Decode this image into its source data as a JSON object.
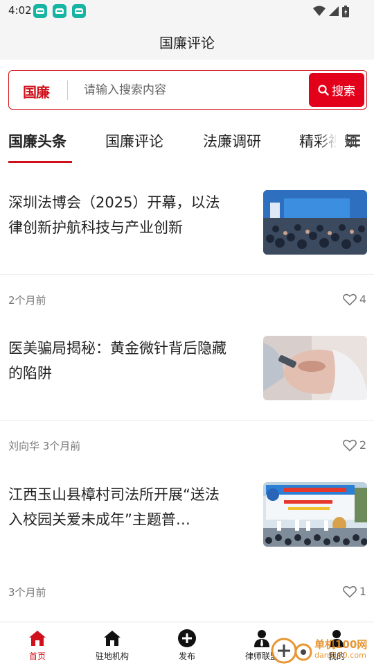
{
  "status_bar": {
    "time": "4:02",
    "notification_icons": [
      "car-app-icon",
      "car-app-icon",
      "car-app-icon"
    ],
    "system_icons": [
      "wifi-icon",
      "signal-icon",
      "battery-icon"
    ]
  },
  "header": {
    "title": "国廉评论"
  },
  "search": {
    "logo_text": "国廉",
    "placeholder": "请输入搜索内容",
    "button_label": "搜索"
  },
  "tabs": [
    {
      "label": "国廉头条",
      "active": true
    },
    {
      "label": "国廉评论",
      "active": false
    },
    {
      "label": "法廉调研",
      "active": false
    },
    {
      "label": "精彩视频",
      "active": false
    }
  ],
  "articles": [
    {
      "title": "深圳法博会（2025）开幕，以法律创新护航科技与产业创新",
      "author": "",
      "time": "2个月前",
      "meta": "2个月前",
      "likes": "4"
    },
    {
      "title": "医美骗局揭秘：黄金微针背后隐藏的陷阱",
      "author": "刘向华",
      "time": "3个月前",
      "meta": "刘向华 3个月前",
      "likes": "2"
    },
    {
      "title": "江西玉山县樟村司法所开展“送法入校园关爱未成年”主题普…",
      "author": "",
      "time": "3个月前",
      "meta": "3个月前",
      "likes": "1"
    }
  ],
  "bottom_nav": [
    {
      "label": "首页",
      "icon": "home-icon",
      "active": true
    },
    {
      "label": "驻地机构",
      "icon": "building-icon",
      "active": false
    },
    {
      "label": "发布",
      "icon": "plus-circle-icon",
      "active": false
    },
    {
      "label": "律师联盟",
      "icon": "lawyer-icon",
      "active": false
    },
    {
      "label": "我的",
      "icon": "user-icon",
      "active": false
    }
  ],
  "watermark": {
    "text": "单机100网",
    "sub": "danji100.com"
  },
  "colors": {
    "brand_red": "#d0101b",
    "button_red": "#e3001b",
    "app_icon_teal": "#17b3a3"
  }
}
